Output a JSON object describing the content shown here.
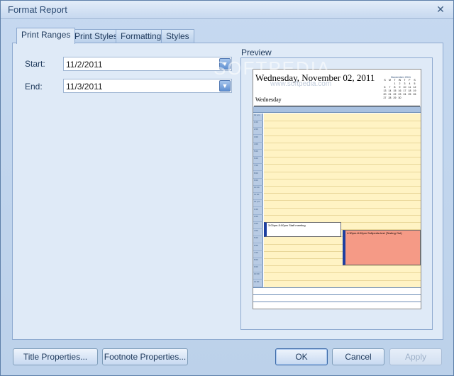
{
  "window": {
    "title": "Format Report"
  },
  "tabs": [
    {
      "label": "Print Ranges",
      "active": true
    },
    {
      "label": "Print Styles",
      "active": false
    },
    {
      "label": "Formatting",
      "active": false
    },
    {
      "label": "Styles",
      "active": false
    }
  ],
  "print_ranges": {
    "start_label": "Start:",
    "start_value": "11/2/2011",
    "end_label": "End:",
    "end_value": "11/3/2011"
  },
  "preview": {
    "label": "Preview",
    "page_date": "Wednesday, November 02, 2011",
    "weekday": "Wednesday",
    "mini_calendar": {
      "title": "November 2011",
      "header": [
        "S",
        "M",
        "T",
        "W",
        "T",
        "F",
        "S"
      ],
      "rows": [
        [
          "",
          "",
          "1",
          "2",
          "3",
          "4",
          "5"
        ],
        [
          "6",
          "7",
          "8",
          "9",
          "10",
          "11",
          "12"
        ],
        [
          "13",
          "14",
          "15",
          "16",
          "17",
          "18",
          "19"
        ],
        [
          "20",
          "21",
          "22",
          "23",
          "24",
          "25",
          "26"
        ],
        [
          "27",
          "28",
          "29",
          "30",
          "",
          "",
          ""
        ]
      ]
    },
    "time_slots": [
      "12 am",
      "1:00",
      "2:00",
      "3:00",
      "4:00",
      "5:00",
      "6:00",
      "7:00",
      "8:00",
      "9:00",
      "10:00",
      "11:00",
      "12 pm",
      "1:00",
      "2:00",
      "3:00",
      "4:00",
      "5:00",
      "6:00",
      "7:00",
      "8:00",
      "9:00",
      "10:00",
      "11:00"
    ],
    "events": [
      {
        "text": "3:00pm-5:00pm Staff meeting"
      },
      {
        "text": "4:30pm-8:00pm Softpedia test (Testing Out)"
      }
    ],
    "watermark": "SOFTPEDIA",
    "watermark_url": "www.softpedia.com"
  },
  "buttons": {
    "title_properties": "Title Properties...",
    "footnote_properties": "Footnote Properties...",
    "ok": "OK",
    "cancel": "Cancel",
    "apply": "Apply"
  },
  "icons": {
    "close": "close-icon",
    "dropdown": "chevron-down-icon"
  }
}
